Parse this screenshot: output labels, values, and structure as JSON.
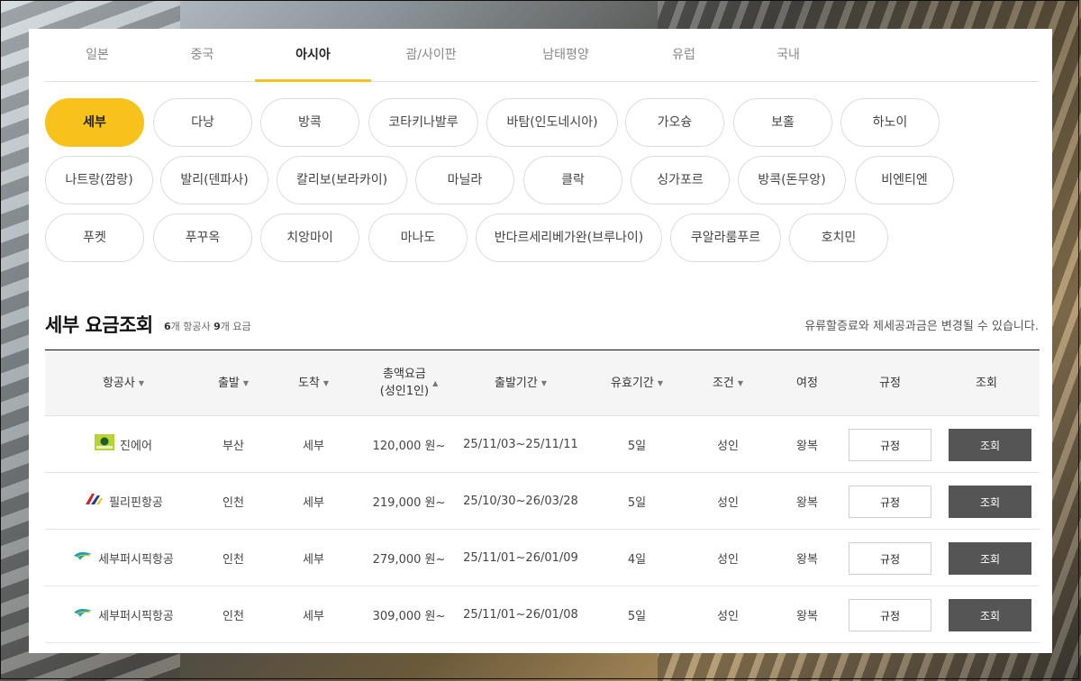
{
  "tabs": [
    {
      "label": "일본",
      "active": false
    },
    {
      "label": "중국",
      "active": false
    },
    {
      "label": "아시아",
      "active": true
    },
    {
      "label": "괌/사이판",
      "active": false
    },
    {
      "label": "남태평양",
      "active": false
    },
    {
      "label": "유럽",
      "active": false
    },
    {
      "label": "국내",
      "active": false
    }
  ],
  "cities": [
    {
      "label": "세부",
      "active": true
    },
    {
      "label": "다낭"
    },
    {
      "label": "방콕"
    },
    {
      "label": "코타키나발루"
    },
    {
      "label": "바탐(인도네시아)"
    },
    {
      "label": "가오슝"
    },
    {
      "label": "보홀"
    },
    {
      "label": "하노이"
    },
    {
      "label": "나트랑(깜랑)"
    },
    {
      "label": "발리(덴파사)"
    },
    {
      "label": "칼리보(보라카이)"
    },
    {
      "label": "마닐라"
    },
    {
      "label": "클락"
    },
    {
      "label": "싱가포르"
    },
    {
      "label": "방콕(돈무앙)"
    },
    {
      "label": "비엔티엔"
    },
    {
      "label": "푸켓"
    },
    {
      "label": "푸꾸옥"
    },
    {
      "label": "치앙마이"
    },
    {
      "label": "마나도"
    },
    {
      "label": "반다르세리베가완(브루나이)"
    },
    {
      "label": "쿠알라룸푸르"
    },
    {
      "label": "호치민"
    }
  ],
  "results": {
    "title": "세부 요금조회",
    "airline_count": "6",
    "airline_unit": "개 항공사",
    "fare_count": "9",
    "fare_unit": "개 요금",
    "notice": "유류할증료와 제세공과금은 변경될 수 있습니다."
  },
  "table": {
    "headers": {
      "airline": "항공사",
      "departure": "출발",
      "arrival": "도착",
      "fare_line1": "총액요금",
      "fare_line2": "(성인1인)",
      "period": "출발기간",
      "validity": "유효기간",
      "condition": "조건",
      "trip": "여정",
      "rules": "규정",
      "view": "조회"
    },
    "sort_down": "▼",
    "sort_up": "▲",
    "rows": [
      {
        "airline": "진에어",
        "logo": "jinair-logo-icon",
        "departure": "부산",
        "arrival": "세부",
        "fare": "120,000 원~",
        "period": "25/11/03~25/11/11",
        "validity": "5일",
        "condition": "성인",
        "trip": "왕복",
        "rule_btn": "규정",
        "view_btn": "조회"
      },
      {
        "airline": "필리핀항공",
        "logo": "philippine-airlines-logo-icon",
        "departure": "인천",
        "arrival": "세부",
        "fare": "219,000 원~",
        "period": "25/10/30~26/03/28",
        "validity": "5일",
        "condition": "성인",
        "trip": "왕복",
        "rule_btn": "규정",
        "view_btn": "조회"
      },
      {
        "airline": "세부퍼시픽항공",
        "logo": "cebu-pacific-logo-icon",
        "departure": "인천",
        "arrival": "세부",
        "fare": "279,000 원~",
        "period": "25/11/01~26/01/09",
        "validity": "4일",
        "condition": "성인",
        "trip": "왕복",
        "rule_btn": "규정",
        "view_btn": "조회"
      },
      {
        "airline": "세부퍼시픽항공",
        "logo": "cebu-pacific-logo-icon",
        "departure": "인천",
        "arrival": "세부",
        "fare": "309,000 원~",
        "period": "25/11/01~26/01/08",
        "validity": "5일",
        "condition": "성인",
        "trip": "왕복",
        "rule_btn": "규정",
        "view_btn": "조회"
      }
    ]
  },
  "colors": {
    "accent": "#f7c21b",
    "view_button": "#555555"
  }
}
